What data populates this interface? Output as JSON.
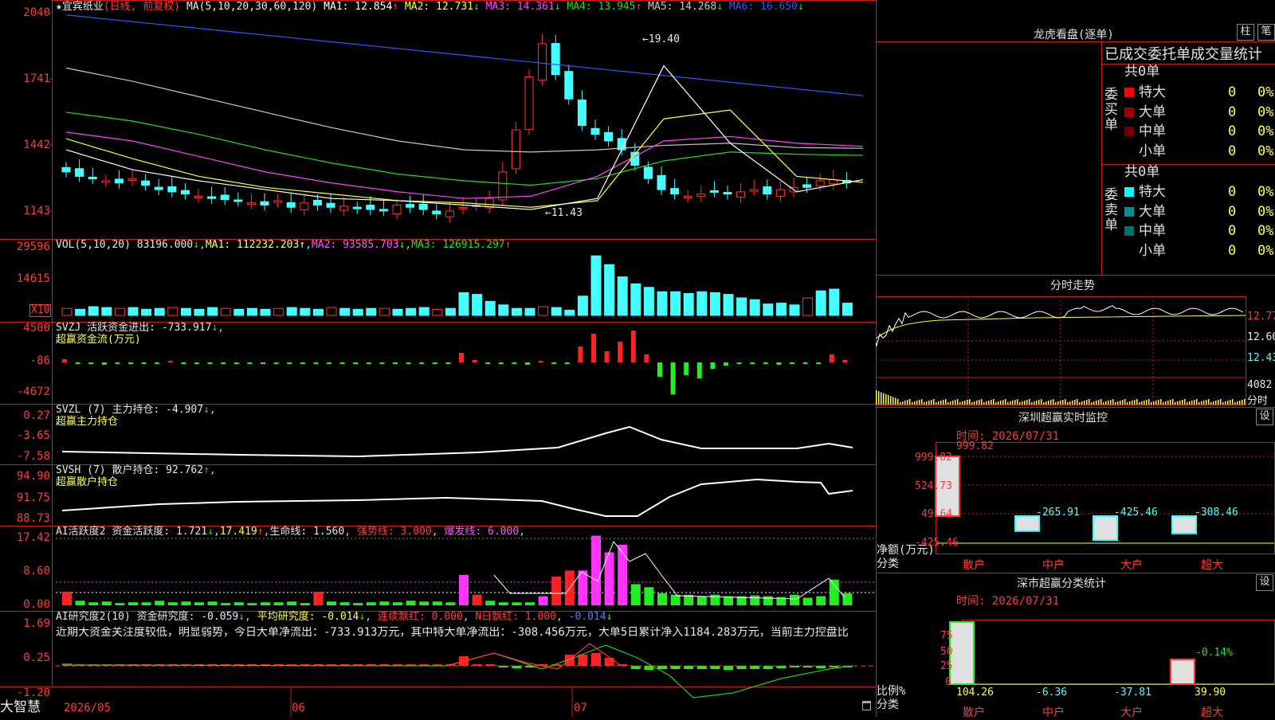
{
  "app": {
    "brand": "大智慧"
  },
  "main_chart": {
    "title": "★宜宾纸业",
    "mode": "(日线, 前复权)",
    "ma_label": "MA(5,10,20,30,60,120)",
    "ma": [
      {
        "name": "MA1",
        "value": "12.854",
        "arrow": "↑",
        "color": "#ffffff"
      },
      {
        "name": "MA2",
        "value": "12.731",
        "arrow": "↓",
        "color": "#ffff33"
      },
      {
        "name": "MA3",
        "value": "14.361",
        "arrow": "↓",
        "color": "#ff44ff"
      },
      {
        "name": "MA4",
        "value": "13.945",
        "arrow": "↑",
        "color": "#22dd22"
      },
      {
        "name": "MA5",
        "value": "14.268",
        "arrow": "↓",
        "color": "#c8c8c8"
      },
      {
        "name": "MA6",
        "value": "16.650",
        "arrow": "↓",
        "color": "#3355ff"
      }
    ],
    "y_ticks": [
      "2040",
      "1741",
      "1442",
      "1143"
    ],
    "high_label": "19.40",
    "low_label": "11.43"
  },
  "vol": {
    "label": "VOL(5,10,20)",
    "value": "83196.000",
    "ma1": "112232.203",
    "ma2": "93585.703",
    "ma3": "126915.297",
    "y_ticks": [
      "29596",
      "14615"
    ],
    "unit": "X10"
  },
  "svzj": {
    "label": "SVZJ",
    "name": "活跃资金进出",
    "value": "-733.917",
    "subtitle": "超赢资金流(万元)",
    "y_ticks": [
      "4500",
      "-86",
      "-4672"
    ]
  },
  "svzl": {
    "label": "SVZL (7)",
    "name": "主力持仓",
    "value": "-4.907",
    "subtitle": "超赢主力持仓",
    "y_ticks": [
      "0.27",
      "-3.65",
      "-7.58"
    ]
  },
  "svsh": {
    "label": "SVSH (7)",
    "name": "散户持仓",
    "value": "92.762",
    "subtitle": "超赢散户持仓",
    "y_ticks": [
      "94.90",
      "91.75",
      "88.73"
    ]
  },
  "ai_active": {
    "label": "AI活跃度2",
    "a_name": "资金活跃度",
    "a_value": "1.721",
    "b_value": "17.419",
    "c_name": "生命线",
    "c_value": "1.560",
    "d_name": "强势线",
    "d_value": "3.000",
    "e_name": "爆发线",
    "e_value": "6.000",
    "y_ticks": [
      "17.42",
      "8.60",
      "0.00"
    ]
  },
  "ai_research": {
    "label": "AI研究度2(10)",
    "a_name": "资金研究度",
    "a_value": "-0.059",
    "b_name": "平均研究度",
    "b_value": "-0.014",
    "c_name": "连续飘红",
    "c_value": "0.000",
    "d_name": "N日飘红",
    "d_value": "1.000",
    "e_value": "-0.014",
    "comment": "近期大资金关注度较低，明显弱势，今日大单净流出：-733.913万元，其中特大单净流出：-308.456万元，大单5日累计净入1184.283万元，当前主力控盘比",
    "y_ticks": [
      "1.69",
      "0.25",
      "-1.20"
    ]
  },
  "x_axis": [
    "2026/05",
    "06",
    "07"
  ],
  "right": {
    "lhb": {
      "title": "龙虎看盘(逐单)",
      "btn1": "柱",
      "btn2": "笔",
      "tabs": "已成交委托单成交量统计",
      "buy_total": "共0单",
      "buy_side": "委买单",
      "sell_total": "共0单",
      "sell_side": "委卖单",
      "buy_rows": [
        {
          "label": "特大",
          "val": "0",
          "pct": "0%",
          "color": "#ff0000"
        },
        {
          "label": "大单",
          "val": "0",
          "pct": "0%",
          "color": "#a00000"
        },
        {
          "label": "中单",
          "val": "0",
          "pct": "0%",
          "color": "#700000"
        },
        {
          "label": "小单",
          "val": "0",
          "pct": "0%",
          "color": "#000000"
        }
      ],
      "sell_rows": [
        {
          "label": "特大",
          "val": "0",
          "pct": "0%",
          "color": "#00ffff"
        },
        {
          "label": "大单",
          "val": "0",
          "pct": "0%",
          "color": "#009090"
        },
        {
          "label": "中单",
          "val": "0",
          "pct": "0%",
          "color": "#007070"
        },
        {
          "label": "小单",
          "val": "0",
          "pct": "0%",
          "color": "#000000"
        }
      ]
    },
    "intraday": {
      "title": "分时走势",
      "y_ticks": [
        "12.77",
        "12.60",
        "12.43"
      ],
      "vol_tick": "4082",
      "vol_label": "分时"
    },
    "monitor": {
      "title": "深圳超赢实时监控",
      "btn": "设",
      "time": "时间: 2026/07/31",
      "y_ticks": [
        "999.82",
        "524.73",
        "49.64",
        "-425.46"
      ],
      "axis_title": "净额(万元)",
      "axis_sub": "分类",
      "chart_data": {
        "type": "bar",
        "categories": [
          "散户",
          "中户",
          "大户",
          "超大"
        ],
        "values": [
          999.82,
          -265.91,
          -425.46,
          -308.46
        ],
        "value_labels": [
          "999.82",
          "-265.91",
          "-425.46",
          "-308.46"
        ],
        "ylim": [
          -425.46,
          999.82
        ]
      }
    },
    "classify": {
      "title": "深市超赢分类统计",
      "btn": "设",
      "time": "时间: 2026/07/31",
      "y_ticks": [
        "75",
        "50",
        "25",
        "0"
      ],
      "axis_title": "比例%",
      "axis_sub": "分类",
      "chart_data": {
        "type": "bar",
        "categories": [
          "散户",
          "中户",
          "大户",
          "超大"
        ],
        "values": [
          104.26,
          -6.36,
          -37.81,
          39.9
        ],
        "value_labels": [
          "104.26",
          "-6.36",
          "-37.81",
          "39.90"
        ],
        "top_label": "-0.14%",
        "ylim": [
          0,
          100
        ]
      }
    }
  }
}
